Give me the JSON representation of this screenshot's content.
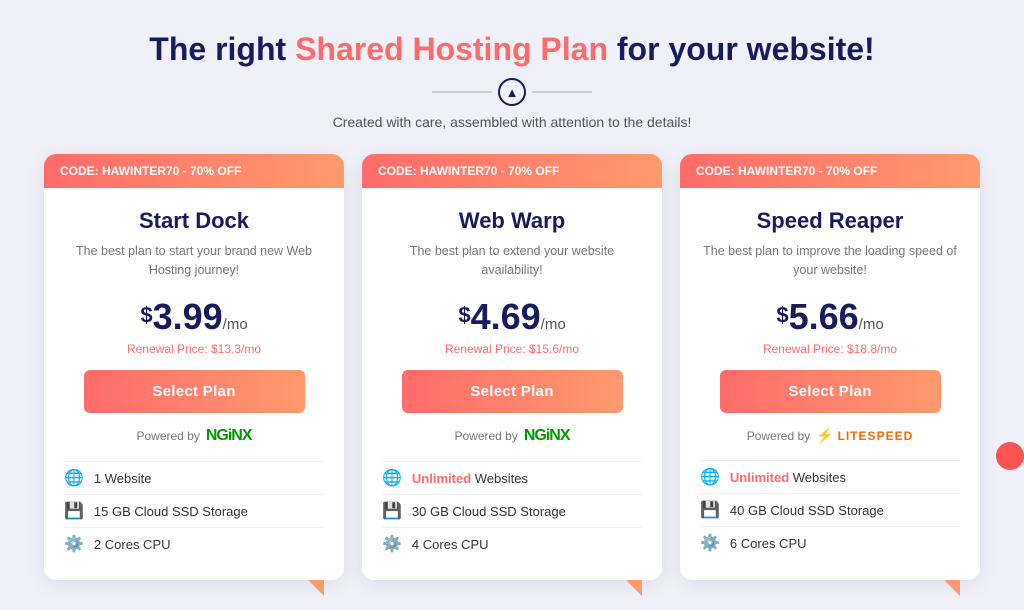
{
  "heading": {
    "title_start": "The right ",
    "title_highlight": "Shared Hosting Plan",
    "title_end": " for your website!",
    "subtitle": "Created with care, assembled with attention to the details!"
  },
  "promo_code": "CODE: HAWINTER70 - 70% OFF",
  "plans": [
    {
      "id": "start-dock",
      "name": "Start Dock",
      "description": "The best plan to start your brand new Web Hosting journey!",
      "price_dollar": "$",
      "price": "3.99",
      "per": "/mo",
      "renewal": "Renewal Price: $13.3/mo",
      "btn_label": "Select Plan",
      "powered_label": "Powered by",
      "engine": "nginx",
      "features": [
        {
          "icon": "🌐",
          "text": "1 Website",
          "bold_part": ""
        },
        {
          "icon": "💾",
          "text": "15 GB Cloud SSD Storage",
          "bold_part": ""
        },
        {
          "icon": "⚙️",
          "text": "2 Cores CPU",
          "bold_part": ""
        }
      ]
    },
    {
      "id": "web-warp",
      "name": "Web Warp",
      "description": "The best plan to extend your website availability!",
      "price_dollar": "$",
      "price": "4.69",
      "per": "/mo",
      "renewal": "Renewal Price: $15.6/mo",
      "btn_label": "Select Plan",
      "powered_label": "Powered by",
      "engine": "nginx",
      "features": [
        {
          "icon": "🌐",
          "text": "Websites",
          "bold_part": "Unlimited",
          "bold_prefix": true
        },
        {
          "icon": "💾",
          "text": "30 GB Cloud SSD Storage",
          "bold_part": ""
        },
        {
          "icon": "⚙️",
          "text": "4 Cores CPU",
          "bold_part": ""
        }
      ]
    },
    {
      "id": "speed-reaper",
      "name": "Speed Reaper",
      "description": "The best plan to improve the loading speed of your website!",
      "price_dollar": "$",
      "price": "5.66",
      "per": "/mo",
      "renewal": "Renewal Price: $18.8/mo",
      "btn_label": "Select Plan",
      "powered_label": "Powered by",
      "engine": "litespeed",
      "features": [
        {
          "icon": "🌐",
          "text": "Websites",
          "bold_part": "Unlimited",
          "bold_prefix": true
        },
        {
          "icon": "💾",
          "text": "40 GB Cloud SSD Storage",
          "bold_part": ""
        },
        {
          "icon": "⚙️",
          "text": "6 Cores CPU",
          "bold_part": ""
        }
      ]
    }
  ]
}
